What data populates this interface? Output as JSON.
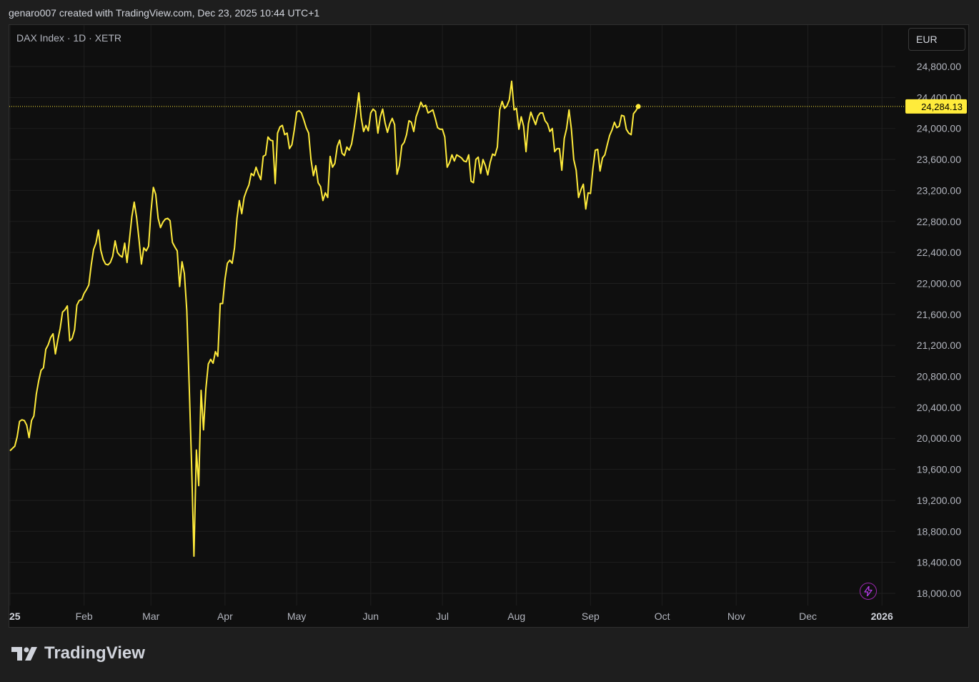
{
  "header": {
    "attribution": "genaro007 created with TradingView.com, Dec 23, 2025 10:44 UTC+1"
  },
  "chart": {
    "symbol_label": "DAX Index · 1D · XETR",
    "currency": "EUR"
  },
  "footer": {
    "brand": "TradingView"
  },
  "colors": {
    "line": "#ffeb3b",
    "background": "#0f0f0f",
    "grid": "#1f1f1f",
    "axis_text": "#b2b5be",
    "price_tag": "#ffeb3b"
  },
  "icons": {
    "lightning": "lightning-icon",
    "logo": "tradingview-logo-icon"
  },
  "chart_data": {
    "type": "line",
    "title": "DAX Index · 1D · XETR",
    "currency": "EUR",
    "ylim": [
      17950,
      25000
    ],
    "xlim": [
      0,
      359
    ],
    "grid": true,
    "y_ticks": [
      {
        "value": 18000,
        "label": "18,000.00"
      },
      {
        "value": 18400,
        "label": "18,400.00"
      },
      {
        "value": 18800,
        "label": "18,800.00"
      },
      {
        "value": 19200,
        "label": "19,200.00"
      },
      {
        "value": 19600,
        "label": "19,600.00"
      },
      {
        "value": 20000,
        "label": "20,000.00"
      },
      {
        "value": 20400,
        "label": "20,400.00"
      },
      {
        "value": 20800,
        "label": "20,800.00"
      },
      {
        "value": 21200,
        "label": "21,200.00"
      },
      {
        "value": 21600,
        "label": "21,600.00"
      },
      {
        "value": 22000,
        "label": "22,000.00"
      },
      {
        "value": 22400,
        "label": "22,400.00"
      },
      {
        "value": 22800,
        "label": "22,800.00"
      },
      {
        "value": 23200,
        "label": "23,200.00"
      },
      {
        "value": 23600,
        "label": "23,600.00"
      },
      {
        "value": 24000,
        "label": "24,000.00"
      },
      {
        "value": 24400,
        "label": "24,400.00"
      },
      {
        "value": 24800,
        "label": "24,800.00"
      }
    ],
    "x_ticks": [
      {
        "day": 0,
        "label": "25",
        "bold": true
      },
      {
        "day": 31,
        "label": "Feb",
        "bold": false
      },
      {
        "day": 59,
        "label": "Mar",
        "bold": false
      },
      {
        "day": 90,
        "label": "Apr",
        "bold": false
      },
      {
        "day": 120,
        "label": "May",
        "bold": false
      },
      {
        "day": 151,
        "label": "Jun",
        "bold": false
      },
      {
        "day": 181,
        "label": "Jul",
        "bold": false
      },
      {
        "day": 212,
        "label": "Aug",
        "bold": false
      },
      {
        "day": 243,
        "label": "Sep",
        "bold": false
      },
      {
        "day": 273,
        "label": "Oct",
        "bold": false
      },
      {
        "day": 304,
        "label": "Nov",
        "bold": false
      },
      {
        "day": 334,
        "label": "Dec",
        "bold": false
      },
      {
        "day": 365,
        "label": "2026",
        "bold": true
      }
    ],
    "last_price": 24284.13,
    "last_price_label": "24,284.13",
    "series": [
      {
        "points": [
          [
            0,
            19840
          ],
          [
            1,
            19870
          ],
          [
            2,
            19900
          ],
          [
            3,
            20020
          ],
          [
            4,
            20220
          ],
          [
            5,
            20240
          ],
          [
            6,
            20230
          ],
          [
            7,
            20170
          ],
          [
            8,
            20010
          ],
          [
            9,
            20230
          ],
          [
            10,
            20290
          ],
          [
            11,
            20570
          ],
          [
            12,
            20740
          ],
          [
            13,
            20880
          ],
          [
            14,
            20910
          ],
          [
            15,
            21150
          ],
          [
            16,
            21210
          ],
          [
            17,
            21300
          ],
          [
            18,
            21350
          ],
          [
            19,
            21090
          ],
          [
            20,
            21270
          ],
          [
            21,
            21420
          ],
          [
            22,
            21630
          ],
          [
            23,
            21660
          ],
          [
            24,
            21710
          ],
          [
            25,
            21260
          ],
          [
            26,
            21290
          ],
          [
            27,
            21400
          ],
          [
            28,
            21720
          ],
          [
            29,
            21780
          ],
          [
            30,
            21790
          ],
          [
            31,
            21870
          ],
          [
            32,
            21920
          ],
          [
            33,
            21980
          ],
          [
            34,
            22240
          ],
          [
            35,
            22440
          ],
          [
            36,
            22520
          ],
          [
            37,
            22690
          ],
          [
            38,
            22430
          ],
          [
            39,
            22310
          ],
          [
            40,
            22250
          ],
          [
            41,
            22240
          ],
          [
            42,
            22270
          ],
          [
            43,
            22350
          ],
          [
            44,
            22550
          ],
          [
            45,
            22400
          ],
          [
            46,
            22360
          ],
          [
            47,
            22340
          ],
          [
            48,
            22520
          ],
          [
            49,
            22270
          ],
          [
            50,
            22570
          ],
          [
            51,
            22860
          ],
          [
            52,
            23050
          ],
          [
            53,
            22850
          ],
          [
            54,
            22570
          ],
          [
            55,
            22250
          ],
          [
            56,
            22460
          ],
          [
            57,
            22420
          ],
          [
            58,
            22480
          ],
          [
            59,
            22920
          ],
          [
            60,
            23240
          ],
          [
            61,
            23150
          ],
          [
            62,
            22840
          ],
          [
            63,
            22720
          ],
          [
            64,
            22790
          ],
          [
            65,
            22830
          ],
          [
            66,
            22840
          ],
          [
            67,
            22810
          ],
          [
            68,
            22530
          ],
          [
            69,
            22470
          ],
          [
            70,
            22420
          ],
          [
            71,
            21960
          ],
          [
            72,
            22280
          ],
          [
            73,
            22130
          ],
          [
            74,
            21650
          ],
          [
            75,
            20700
          ],
          [
            76,
            19670
          ],
          [
            77,
            18480
          ],
          [
            78,
            19850
          ],
          [
            79,
            19390
          ],
          [
            80,
            20620
          ],
          [
            81,
            20110
          ],
          [
            82,
            20640
          ],
          [
            83,
            20960
          ],
          [
            84,
            21020
          ],
          [
            85,
            20970
          ],
          [
            86,
            21120
          ],
          [
            87,
            21060
          ],
          [
            88,
            21740
          ],
          [
            89,
            21740
          ],
          [
            90,
            22060
          ],
          [
            91,
            22260
          ],
          [
            92,
            22300
          ],
          [
            93,
            22260
          ],
          [
            94,
            22460
          ],
          [
            95,
            22840
          ],
          [
            96,
            23070
          ],
          [
            97,
            22900
          ],
          [
            98,
            23110
          ],
          [
            99,
            23200
          ],
          [
            100,
            23270
          ],
          [
            101,
            23420
          ],
          [
            102,
            23390
          ],
          [
            103,
            23500
          ],
          [
            104,
            23410
          ],
          [
            105,
            23340
          ],
          [
            106,
            23640
          ],
          [
            107,
            23660
          ],
          [
            108,
            23890
          ],
          [
            109,
            23850
          ],
          [
            110,
            23840
          ],
          [
            111,
            23290
          ],
          [
            112,
            23940
          ],
          [
            113,
            24020
          ],
          [
            114,
            24040
          ],
          [
            115,
            23920
          ],
          [
            116,
            23940
          ],
          [
            117,
            23740
          ],
          [
            118,
            23790
          ],
          [
            119,
            23980
          ],
          [
            120,
            24210
          ],
          [
            121,
            24230
          ],
          [
            122,
            24200
          ],
          [
            123,
            24110
          ],
          [
            124,
            24010
          ],
          [
            125,
            23940
          ],
          [
            126,
            23600
          ],
          [
            127,
            23390
          ],
          [
            128,
            23520
          ],
          [
            129,
            23300
          ],
          [
            130,
            23250
          ],
          [
            131,
            23070
          ],
          [
            132,
            23170
          ],
          [
            133,
            23110
          ],
          [
            134,
            23640
          ],
          [
            135,
            23500
          ],
          [
            136,
            23550
          ],
          [
            137,
            23770
          ],
          [
            138,
            23850
          ],
          [
            139,
            23680
          ],
          [
            140,
            23650
          ],
          [
            141,
            23760
          ],
          [
            142,
            23720
          ],
          [
            143,
            23800
          ],
          [
            144,
            23990
          ],
          [
            145,
            24200
          ],
          [
            146,
            24460
          ],
          [
            147,
            24140
          ],
          [
            148,
            23960
          ],
          [
            149,
            24040
          ],
          [
            150,
            23970
          ],
          [
            151,
            24200
          ],
          [
            152,
            24250
          ],
          [
            153,
            24220
          ],
          [
            154,
            23940
          ],
          [
            155,
            24150
          ],
          [
            156,
            24250
          ],
          [
            157,
            24070
          ],
          [
            158,
            23950
          ],
          [
            159,
            24060
          ],
          [
            160,
            24130
          ],
          [
            161,
            24050
          ],
          [
            162,
            23410
          ],
          [
            163,
            23520
          ],
          [
            164,
            23780
          ],
          [
            165,
            23820
          ],
          [
            166,
            23920
          ],
          [
            167,
            24100
          ],
          [
            168,
            24080
          ],
          [
            169,
            23960
          ],
          [
            170,
            24150
          ],
          [
            171,
            24240
          ],
          [
            172,
            24340
          ],
          [
            173,
            24280
          ],
          [
            174,
            24300
          ],
          [
            175,
            24200
          ],
          [
            176,
            24220
          ],
          [
            177,
            24240
          ],
          [
            178,
            24130
          ],
          [
            179,
            24010
          ],
          [
            180,
            23990
          ],
          [
            181,
            23990
          ],
          [
            182,
            23890
          ],
          [
            183,
            23500
          ],
          [
            184,
            23560
          ],
          [
            185,
            23660
          ],
          [
            186,
            23580
          ],
          [
            187,
            23660
          ],
          [
            188,
            23640
          ],
          [
            189,
            23620
          ],
          [
            190,
            23580
          ],
          [
            191,
            23570
          ],
          [
            192,
            23660
          ],
          [
            193,
            23320
          ],
          [
            194,
            23300
          ],
          [
            195,
            23600
          ],
          [
            196,
            23630
          ],
          [
            197,
            23420
          ],
          [
            198,
            23600
          ],
          [
            199,
            23520
          ],
          [
            200,
            23400
          ],
          [
            201,
            23560
          ],
          [
            202,
            23670
          ],
          [
            203,
            23650
          ],
          [
            204,
            23760
          ],
          [
            205,
            24240
          ],
          [
            206,
            24350
          ],
          [
            207,
            24260
          ],
          [
            208,
            24290
          ],
          [
            209,
            24370
          ],
          [
            210,
            24610
          ],
          [
            211,
            24240
          ],
          [
            212,
            24260
          ],
          [
            213,
            23990
          ],
          [
            214,
            24150
          ],
          [
            215,
            24030
          ],
          [
            216,
            23700
          ],
          [
            217,
            24060
          ],
          [
            218,
            24210
          ],
          [
            219,
            24130
          ],
          [
            220,
            24050
          ],
          [
            221,
            24160
          ],
          [
            222,
            24200
          ],
          [
            223,
            24200
          ],
          [
            224,
            24100
          ],
          [
            225,
            24060
          ],
          [
            226,
            23960
          ],
          [
            227,
            24000
          ],
          [
            228,
            23700
          ],
          [
            229,
            23740
          ],
          [
            230,
            23740
          ],
          [
            231,
            23460
          ],
          [
            232,
            23870
          ],
          [
            233,
            24000
          ],
          [
            234,
            24240
          ],
          [
            235,
            23990
          ],
          [
            236,
            23600
          ],
          [
            237,
            23460
          ],
          [
            238,
            23110
          ],
          [
            239,
            23210
          ],
          [
            240,
            23280
          ],
          [
            241,
            22960
          ],
          [
            242,
            23170
          ],
          [
            243,
            23160
          ],
          [
            244,
            23480
          ],
          [
            245,
            23720
          ],
          [
            246,
            23730
          ],
          [
            247,
            23450
          ],
          [
            248,
            23620
          ],
          [
            249,
            23660
          ],
          [
            250,
            23790
          ],
          [
            251,
            23910
          ],
          [
            252,
            23980
          ],
          [
            253,
            24080
          ],
          [
            254,
            24010
          ],
          [
            255,
            24030
          ],
          [
            256,
            24170
          ],
          [
            257,
            24160
          ],
          [
            258,
            23990
          ],
          [
            259,
            23940
          ],
          [
            260,
            23920
          ],
          [
            261,
            24190
          ],
          [
            262,
            24230
          ],
          [
            263,
            24284
          ]
        ]
      }
    ]
  }
}
